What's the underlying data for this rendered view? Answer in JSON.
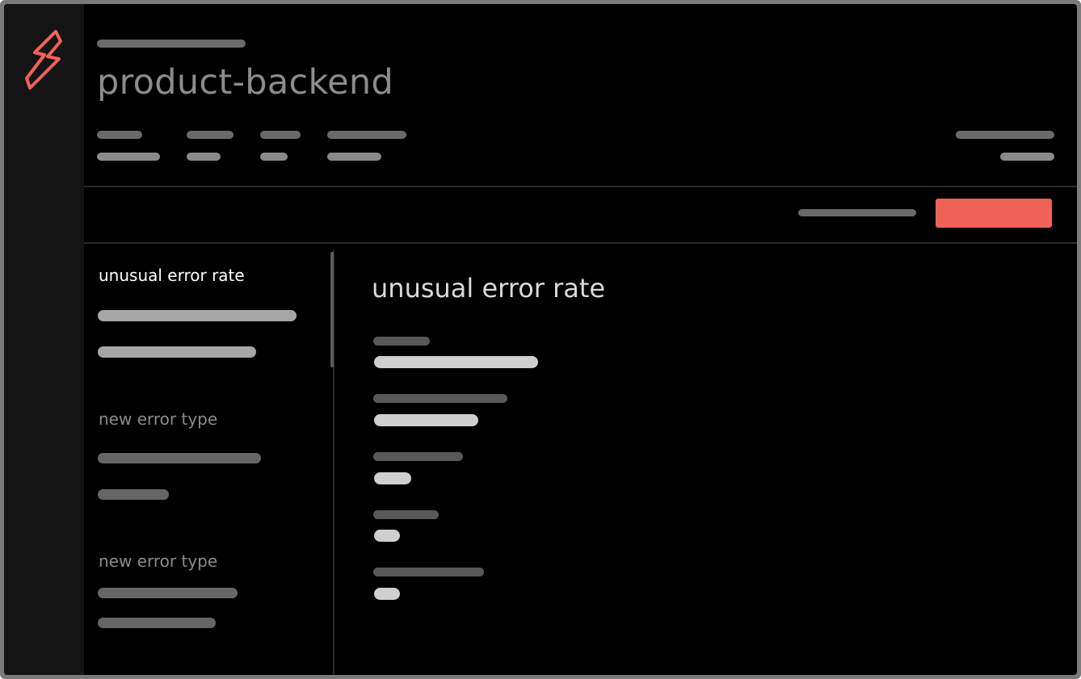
{
  "app": {
    "icon": "lightning-bolt-icon",
    "accent_color": "#ef6257"
  },
  "header": {
    "title": "product-backend"
  },
  "toolbar": {
    "primary_button_color": "#ef6257"
  },
  "alerts_list": {
    "items": [
      {
        "title": "unusual error rate",
        "active": true
      },
      {
        "title": "new error type",
        "active": false
      },
      {
        "title": "new error type",
        "active": false
      }
    ]
  },
  "detail": {
    "title": "unusual error rate"
  }
}
